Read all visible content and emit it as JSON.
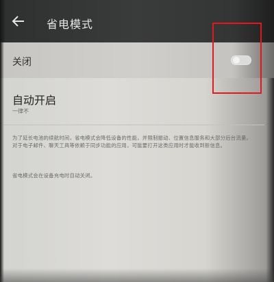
{
  "header": {
    "title": "省电模式",
    "back_icon": "arrow-left-icon"
  },
  "power_saving": {
    "label": "关闭",
    "enabled": false
  },
  "auto_on": {
    "label": "自动开启",
    "value": "一律不"
  },
  "description": {
    "text": "为了延长电池的续航时间，省电模式会降低设备的性能，并限制振动、位置信息服务和大部分后台流量。对于电子邮件、聊天工具等依赖于同步功能的应用，可能要打开这类应用时才能收到新信息。",
    "note": "省电模式会在设备充电时自动关闭。"
  },
  "colors": {
    "appbar": "#3a3b3b",
    "background": "#dddcd8",
    "highlight": "#e4171c"
  }
}
